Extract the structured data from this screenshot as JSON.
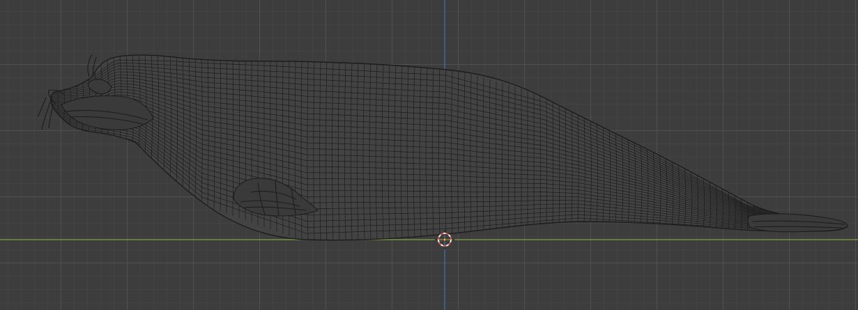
{
  "viewport": {
    "mode": "orthographic-side-view",
    "shading": "wireframe",
    "object": "seal-mesh",
    "colors": {
      "background": "#3d3d3d",
      "grid_major": "#555555",
      "grid_minor": "#474747",
      "wire": "#1c1c1c",
      "x_axis": "#7fa33f",
      "z_axis": "#3f6fb0",
      "cursor_ring_a": "#e05050",
      "cursor_ring_b": "#f0f0f0"
    },
    "icons": {
      "cursor": "3d-cursor-icon",
      "origin": "object-origin-icon"
    }
  }
}
